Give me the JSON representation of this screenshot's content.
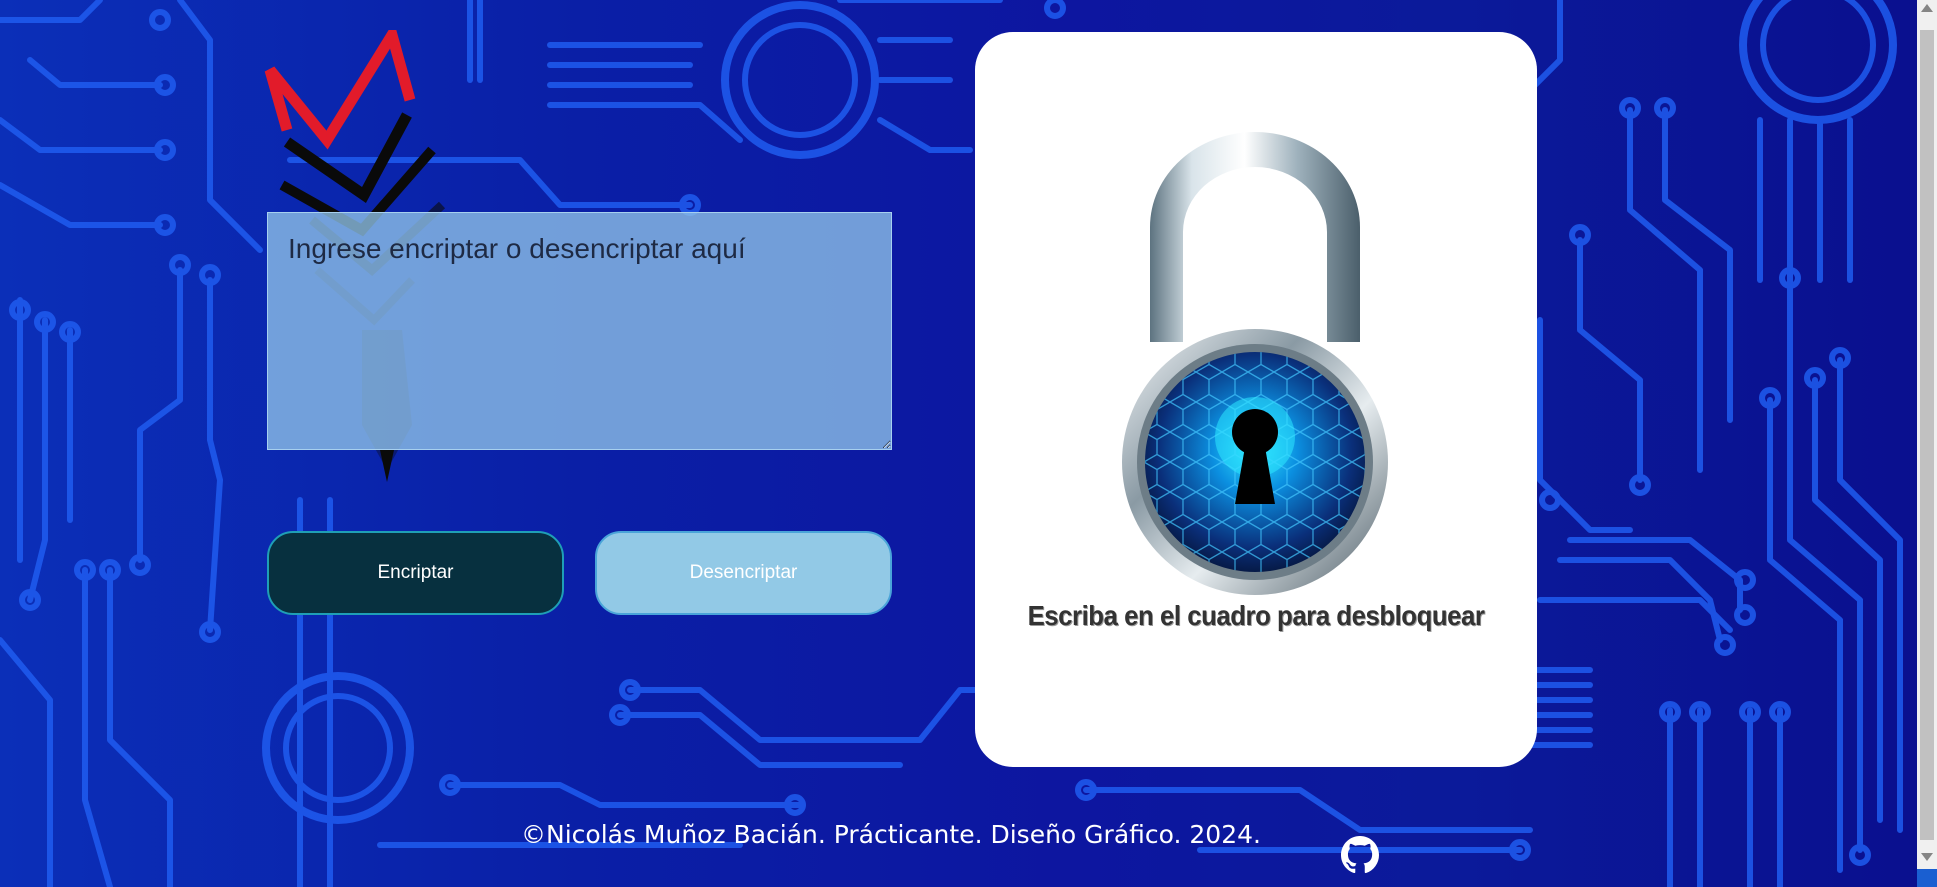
{
  "input": {
    "placeholder": "Ingrese encriptar o desencriptar aquí"
  },
  "buttons": {
    "encrypt_label": "Encriptar",
    "decrypt_label": "Desencriptar"
  },
  "card": {
    "message": "Escriba en el cuadro para desbloquear"
  },
  "footer": {
    "text": "©Nicolás Muñoz Bacián. Prácticante. Diseño Gráfico. 2024."
  },
  "colors": {
    "background": "#0b1fa6",
    "circuit": "#1e5bff",
    "encrypt_button": "#07303f",
    "decrypt_button": "#92c9e6",
    "card": "#ffffff"
  },
  "icons": [
    "logo-icon",
    "padlock-icon",
    "github-icon"
  ]
}
